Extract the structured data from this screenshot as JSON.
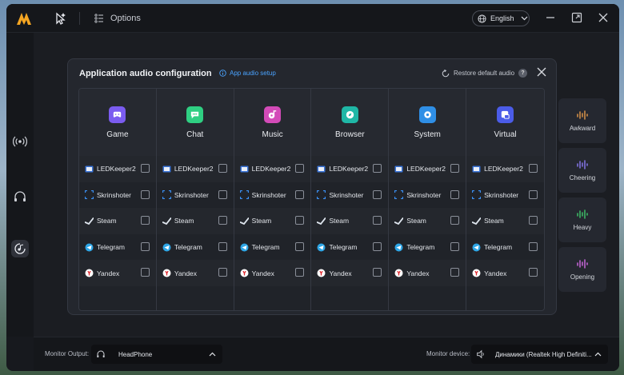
{
  "topbar": {
    "options_label": "Options",
    "language": "English"
  },
  "right_cards": [
    {
      "label": "Awkward",
      "color": "#e79a4b"
    },
    {
      "label": "Cheering",
      "color": "#8b7cf6"
    },
    {
      "label": "Heavy",
      "color": "#3fc96b"
    },
    {
      "label": "Opening",
      "color": "#d36be6"
    }
  ],
  "bottom": {
    "monitor_output_label": "Monitor Output:",
    "monitor_output_value": "HeadPhone",
    "monitor_device_label": "Monitor device:",
    "monitor_device_value": "Динамики (Realtek High Definiti..."
  },
  "modal": {
    "title": "Application audio configuration",
    "setup_link": "App audio setup",
    "restore_label": "Restore default audio",
    "help_glyph": "?",
    "categories": [
      {
        "label": "Game",
        "color": "#7b5cf0",
        "icon": "gamepad-icon"
      },
      {
        "label": "Chat",
        "color": "#2fcf82",
        "icon": "chat-icon"
      },
      {
        "label": "Music",
        "color": "#d34bb8",
        "icon": "music-icon"
      },
      {
        "label": "Browser",
        "color": "#1fb7a6",
        "icon": "compass-icon"
      },
      {
        "label": "System",
        "color": "#2f8fe6",
        "icon": "gear-icon"
      },
      {
        "label": "Virtual",
        "color": "#4b5ce8",
        "icon": "virtual-icon"
      }
    ],
    "apps": [
      {
        "name": "LEDKeeper2",
        "icon": "ledkeeper-icon"
      },
      {
        "name": "Skrinshoter",
        "icon": "screenshot-icon"
      },
      {
        "name": "Steam",
        "icon": "steam-icon"
      },
      {
        "name": "Telegram",
        "icon": "telegram-icon"
      },
      {
        "name": "Yandex",
        "icon": "yandex-icon"
      }
    ]
  }
}
